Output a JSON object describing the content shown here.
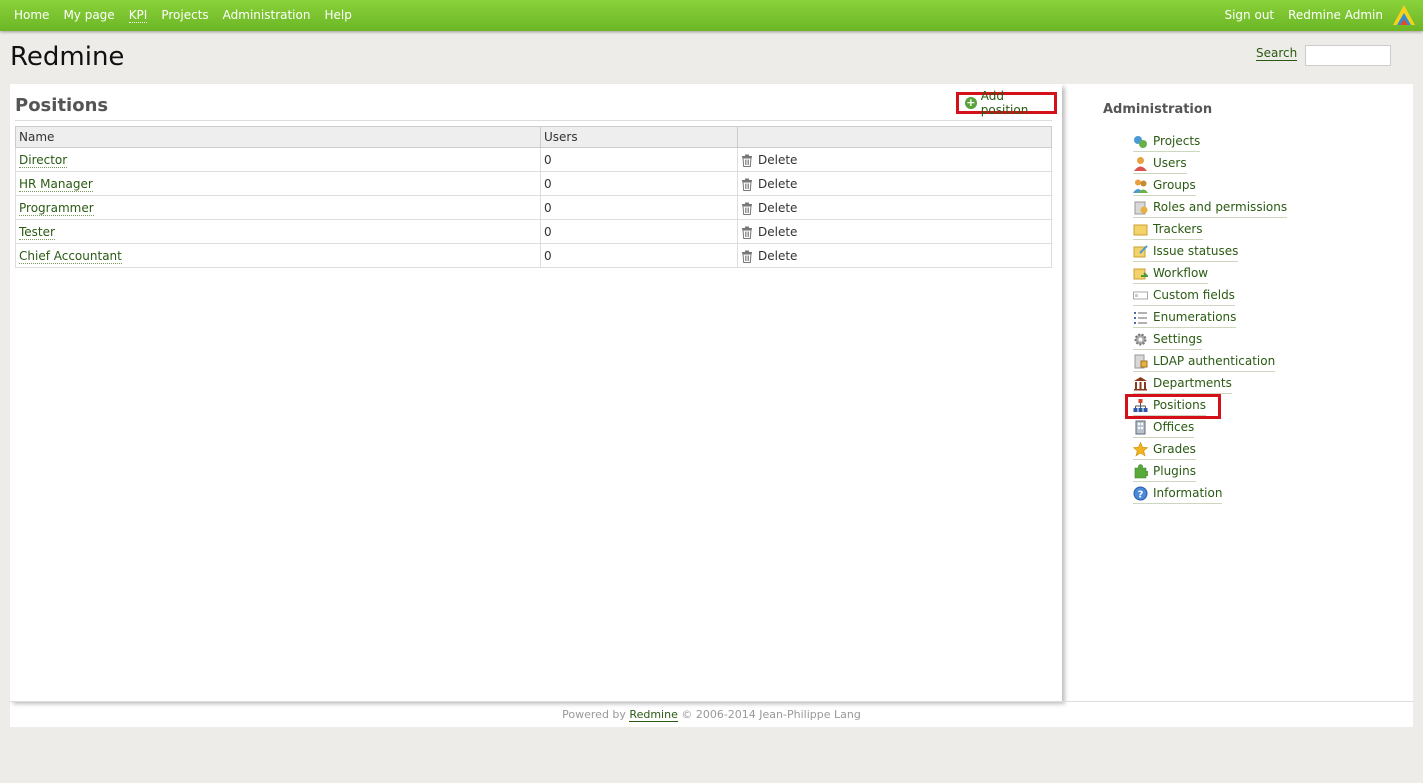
{
  "top_menu": {
    "items": [
      "Home",
      "My page",
      "KPI",
      "Projects",
      "Administration",
      "Help"
    ],
    "sign_out": "Sign out",
    "user": "Redmine Admin"
  },
  "header": {
    "title": "Redmine",
    "search_label": "Search",
    "search_value": ""
  },
  "content": {
    "title": "Positions",
    "add_label": "Add position",
    "columns": [
      "Name",
      "Users",
      ""
    ],
    "rows": [
      {
        "name": "Director",
        "users": "0",
        "action": "Delete"
      },
      {
        "name": "HR Manager",
        "users": "0",
        "action": "Delete"
      },
      {
        "name": "Programmer",
        "users": "0",
        "action": "Delete"
      },
      {
        "name": "Tester",
        "users": "0",
        "action": "Delete"
      },
      {
        "name": "Chief Accountant",
        "users": "0",
        "action": "Delete"
      }
    ]
  },
  "sidebar": {
    "title": "Administration",
    "items": [
      {
        "label": "Projects",
        "icon": "projects-icon"
      },
      {
        "label": "Users",
        "icon": "user-icon"
      },
      {
        "label": "Groups",
        "icon": "group-icon"
      },
      {
        "label": "Roles and permissions",
        "icon": "roles-icon"
      },
      {
        "label": "Trackers",
        "icon": "tracker-icon"
      },
      {
        "label": "Issue statuses",
        "icon": "issue-status-icon"
      },
      {
        "label": "Workflow",
        "icon": "workflow-icon"
      },
      {
        "label": "Custom fields",
        "icon": "custom-fields-icon"
      },
      {
        "label": "Enumerations",
        "icon": "list-icon"
      },
      {
        "label": "Settings",
        "icon": "gear-icon"
      },
      {
        "label": "LDAP authentication",
        "icon": "ldap-icon"
      },
      {
        "label": "Departments",
        "icon": "building-icon"
      },
      {
        "label": "Positions",
        "icon": "org-chart-icon"
      },
      {
        "label": "Offices",
        "icon": "office-icon"
      },
      {
        "label": "Grades",
        "icon": "star-icon"
      },
      {
        "label": "Plugins",
        "icon": "puzzle-icon"
      },
      {
        "label": "Information",
        "icon": "info-icon"
      }
    ]
  },
  "footer": {
    "prefix": "Powered by",
    "link": "Redmine",
    "suffix": "© 2006-2014 Jean-Philippe Lang"
  },
  "colors": {
    "accent": "#6cb626",
    "link": "#2a5a12",
    "highlight": "#d4111a"
  }
}
